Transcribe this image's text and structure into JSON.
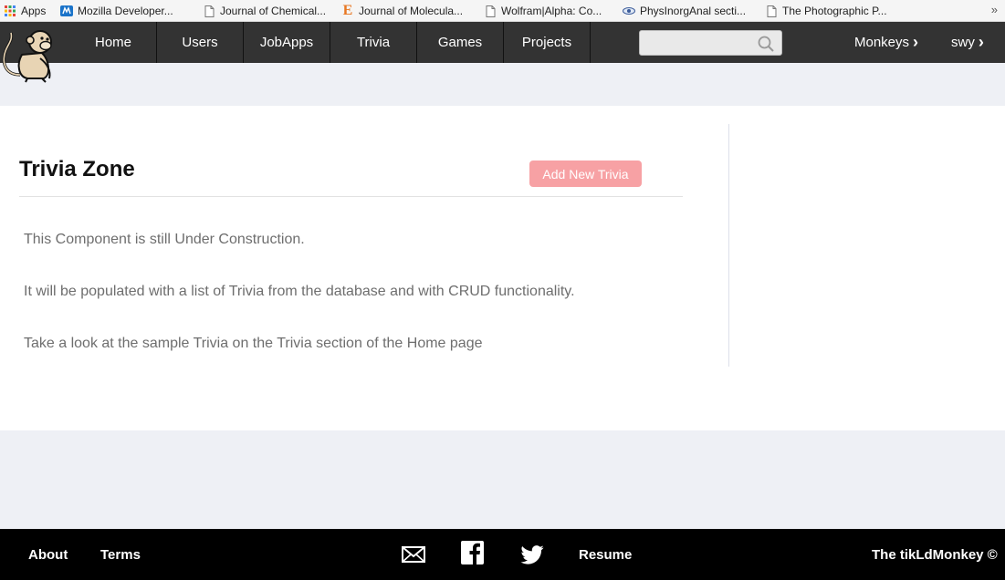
{
  "bookmarks": {
    "items": [
      {
        "label": "Apps",
        "icon": "apps-grid-icon"
      },
      {
        "label": "Mozilla Developer...",
        "icon": "mdn-icon"
      },
      {
        "label": "Journal of Chemical...",
        "icon": "page-icon"
      },
      {
        "label": "Journal of Molecula...",
        "icon": "elsevier-icon"
      },
      {
        "label": "Wolfram|Alpha: Co...",
        "icon": "page-icon"
      },
      {
        "label": "PhysInorgAnal secti...",
        "icon": "eye-icon"
      },
      {
        "label": "The Photographic P...",
        "icon": "page-icon"
      }
    ],
    "more": "»"
  },
  "nav": {
    "items": [
      "Home",
      "Users",
      "JobApps",
      "Trivia",
      "Games",
      "Projects"
    ],
    "search": {
      "value": "",
      "placeholder": ""
    },
    "monkeys": "Monkeys",
    "user": "swy",
    "chevron": "›"
  },
  "main": {
    "title": "Trivia Zone",
    "add_button": "Add New Trivia",
    "paragraphs": [
      "This Component is still Under Construction.",
      "It will be populated with a list of Trivia from the database and with CRUD functionality.",
      "Take a look at the sample Trivia on the Trivia section of the Home page"
    ]
  },
  "footer": {
    "about": "About",
    "terms": "Terms",
    "resume": "Resume",
    "copyright": "The tikLdMonkey ©"
  },
  "colors": {
    "nav_bg": "#333333",
    "button_bg": "#f7a1a4",
    "page_bg": "#eef0f5",
    "footer_bg": "#000000"
  }
}
